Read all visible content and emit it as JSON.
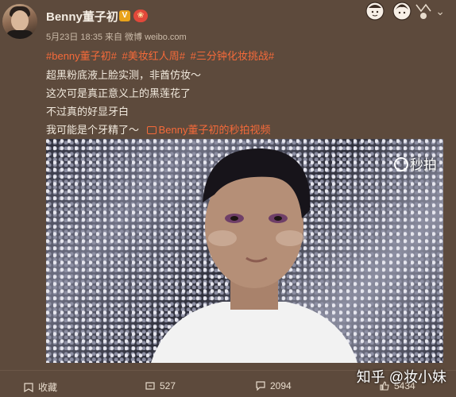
{
  "post": {
    "username": "Benny董子初",
    "verified_badge": "V",
    "vip_badge": "vip-icon",
    "meta": "5月23日 18:35 来自 微博 weibo.com",
    "tags": [
      "#benny董子初#",
      "#美妆红人周#",
      "#三分钟化妆挑战#"
    ],
    "lines": [
      "超黑粉底液上脸实测，非酋仿妆～",
      "这次可是真正意义上的黑莲花了",
      "不过真的好显牙白",
      "我可能是个牙精了～"
    ],
    "video_link": "Benny董子初的秒拍视频"
  },
  "video": {
    "watermark": "秒拍"
  },
  "actions": {
    "favorite": "收藏",
    "repost": "527",
    "comment": "2094",
    "like": "5434"
  },
  "credit": "知乎 @妆小妹",
  "colors": {
    "background": "#5d4a3c",
    "accent": "#f56a3a",
    "badge": "#e9a31a"
  }
}
